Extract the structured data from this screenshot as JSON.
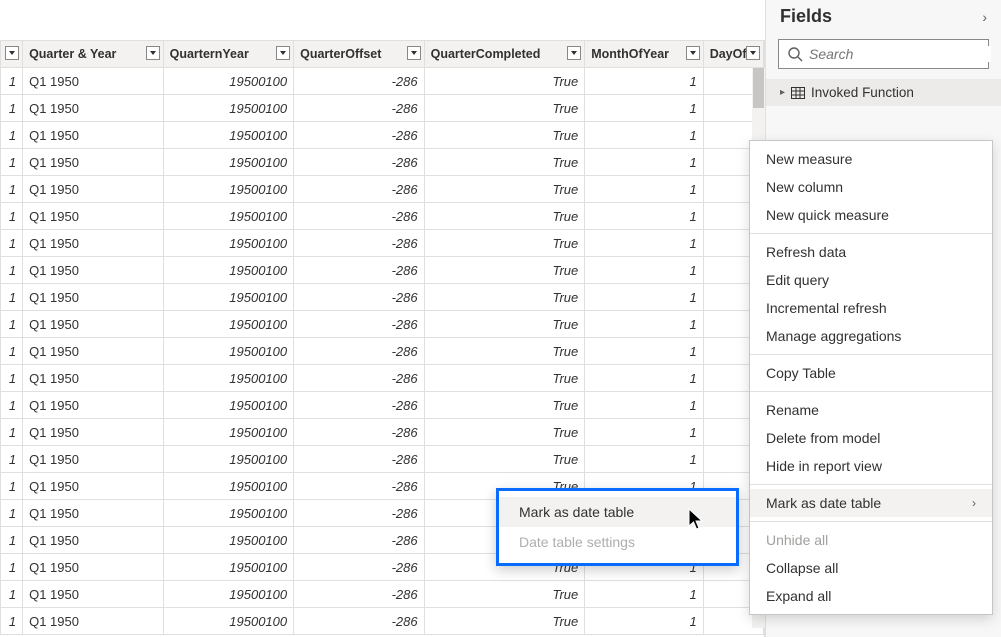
{
  "fields": {
    "title": "Fields",
    "search_placeholder": "Search",
    "table_label": "Invoked Function"
  },
  "columns": [
    {
      "key": "idx",
      "label": ""
    },
    {
      "key": "qy",
      "label": "Quarter & Year"
    },
    {
      "key": "qn",
      "label": "QuarternYear"
    },
    {
      "key": "qo",
      "label": "QuarterOffset"
    },
    {
      "key": "qc",
      "label": "QuarterCompleted"
    },
    {
      "key": "my",
      "label": "MonthOfYear"
    },
    {
      "key": "do",
      "label": "DayOf"
    }
  ],
  "row_model": {
    "idx": "1",
    "qy": "Q1 1950",
    "qn": "19500100",
    "qo": "-286",
    "qc": "True",
    "my": "1"
  },
  "row_count": 21,
  "context_menu": [
    {
      "label": "New measure",
      "type": "item"
    },
    {
      "label": "New column",
      "type": "item"
    },
    {
      "label": "New quick measure",
      "type": "item"
    },
    {
      "type": "sep"
    },
    {
      "label": "Refresh data",
      "type": "item"
    },
    {
      "label": "Edit query",
      "type": "item"
    },
    {
      "label": "Incremental refresh",
      "type": "item"
    },
    {
      "label": "Manage aggregations",
      "type": "item"
    },
    {
      "type": "sep"
    },
    {
      "label": "Copy Table",
      "type": "item"
    },
    {
      "type": "sep"
    },
    {
      "label": "Rename",
      "type": "item"
    },
    {
      "label": "Delete from model",
      "type": "item"
    },
    {
      "label": "Hide in report view",
      "type": "item"
    },
    {
      "type": "sep"
    },
    {
      "label": "Mark as date table",
      "type": "item",
      "submenu": true,
      "highlight": true
    },
    {
      "type": "sep"
    },
    {
      "label": "Unhide all",
      "type": "item",
      "disabled": true
    },
    {
      "label": "Collapse all",
      "type": "item"
    },
    {
      "label": "Expand all",
      "type": "item"
    }
  ],
  "submenu": [
    {
      "label": "Mark as date table",
      "hover": true
    },
    {
      "label": "Date table settings",
      "disabled": true
    }
  ]
}
